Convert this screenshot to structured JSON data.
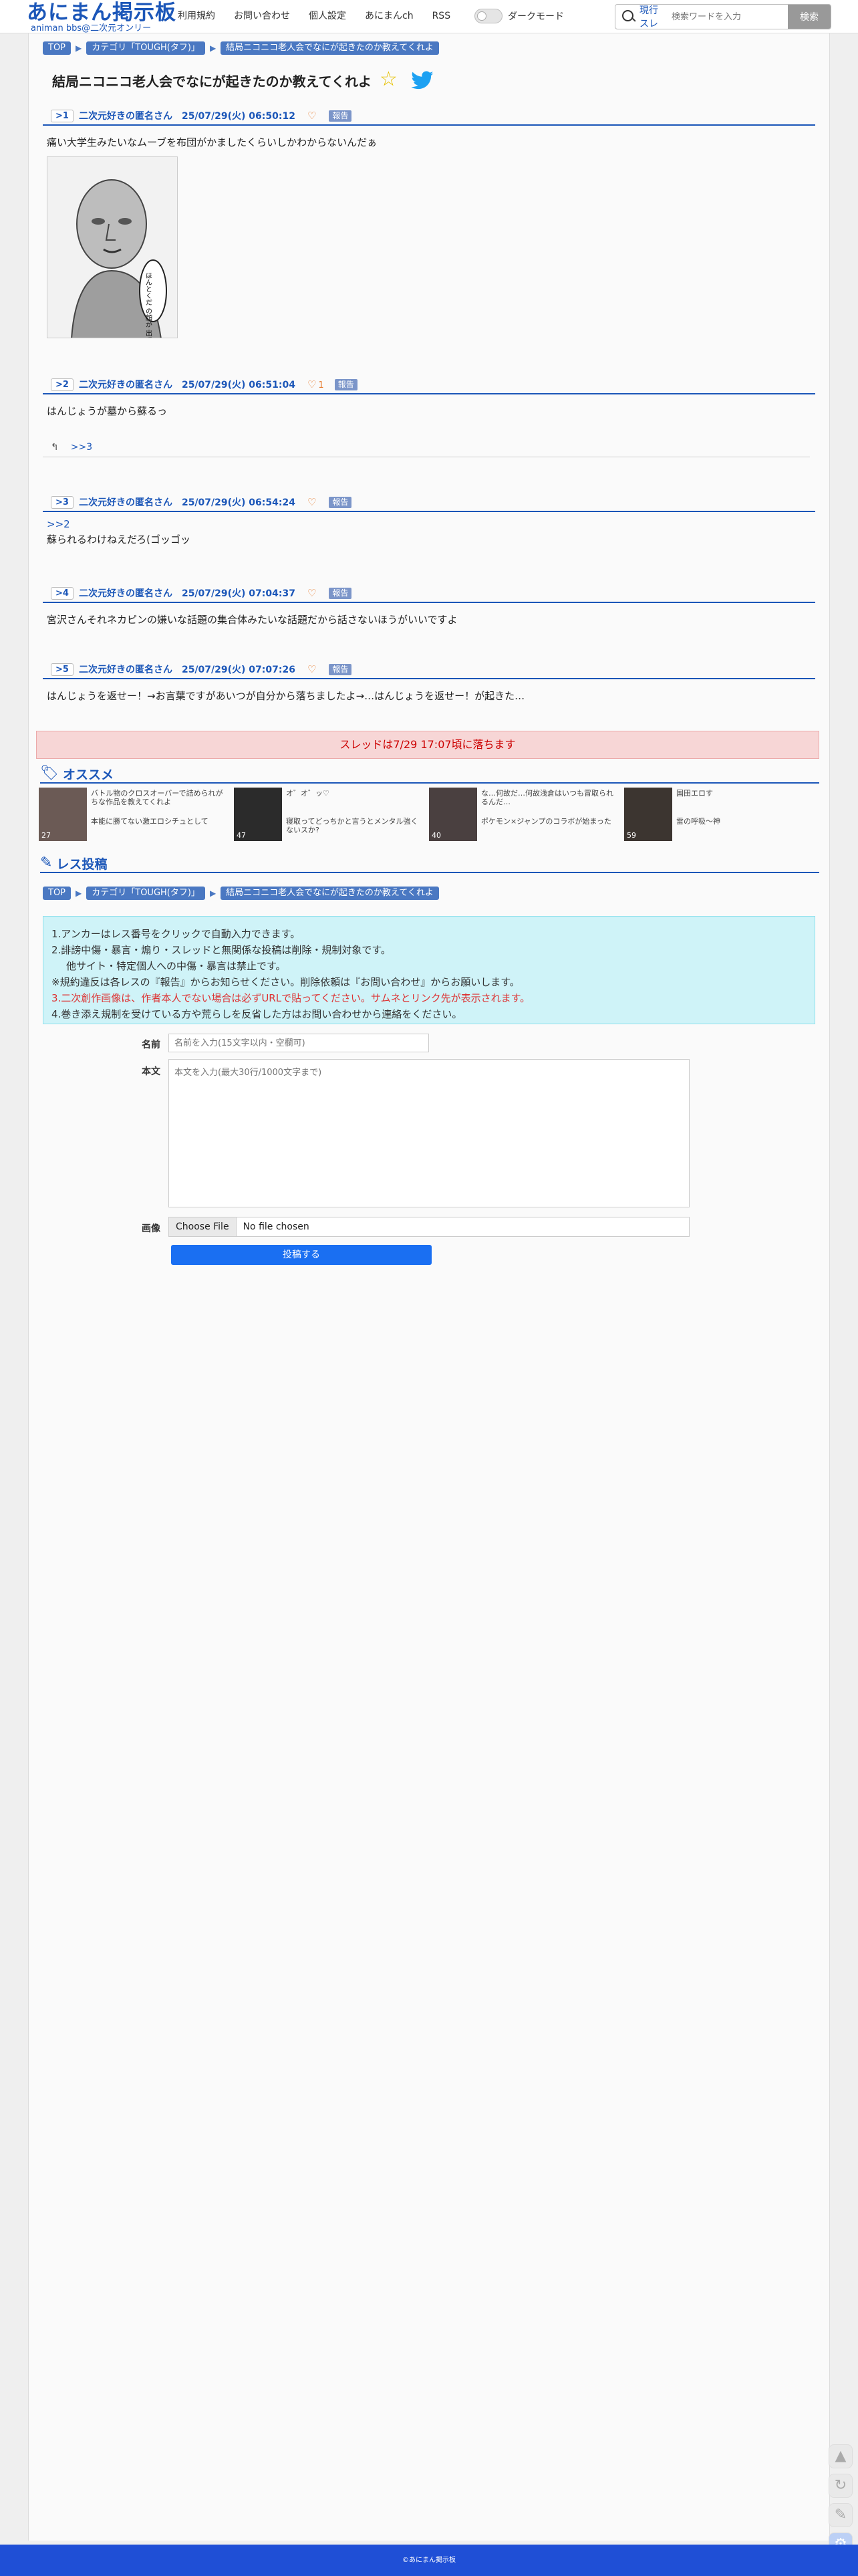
{
  "header": {
    "logo_main": "あにまん掲示板",
    "logo_sub": "animan bbs@二次元オンリー",
    "nav": [
      "利用規約",
      "お問い合わせ",
      "個人設定",
      "あにまんch",
      "RSS"
    ],
    "dark_mode_label": "ダークモード",
    "search_scope": "現行スレ",
    "search_placeholder": "検索ワードを入力",
    "search_button": "検索"
  },
  "breadcrumb": [
    "TOP",
    "カテゴリ「TOUGH(タフ)」",
    "結局ニコニコ老人会でなにが起きたのか教えてくれよ"
  ],
  "thread_title": "結局ニコニコ老人会でなにが起きたのか教えてくれよ",
  "posts": [
    {
      "num": ">1",
      "name": "二次元好きの匿名さん",
      "date": "25/07/29(火) 06:50:12",
      "likes": "",
      "report": "報告",
      "anchor": "",
      "body": "痛い大学生みたいなムーブを布団がかましたくらいしかわからないんだぁ"
    },
    {
      "num": ">2",
      "name": "二次元好きの匿名さん",
      "date": "25/07/29(火) 06:51:04",
      "likes": "1",
      "report": "報告",
      "anchor": "",
      "body": "はんじょうが墓から蘇るっ"
    },
    {
      "num": ">3",
      "name": "二次元好きの匿名さん",
      "date": "25/07/29(火) 06:54:24",
      "likes": "",
      "report": "報告",
      "anchor": ">>2",
      "body": "蘇られるわけねえだろ(ゴッゴッ"
    },
    {
      "num": ">4",
      "name": "二次元好きの匿名さん",
      "date": "25/07/29(火) 07:04:37",
      "likes": "",
      "report": "報告",
      "anchor": "",
      "body": "宮沢さんそれネカピンの嫌いな話題の集合体みたいな話題だから話さないほうがいいですよ"
    },
    {
      "num": ">5",
      "name": "二次元好きの匿名さん",
      "date": "25/07/29(火) 07:07:26",
      "likes": "",
      "report": "報告",
      "anchor": "",
      "body": "はんじょうを返せー！→お言葉ですがあいつが自分から落ちましたよ→…はんじょうを返せー！が起きた…"
    }
  ],
  "post1_image_caption": "ほんとくだ の顔が 出てきた",
  "post2_reply_link": ">>3",
  "expired_notice": "スレッドは7/29 17:07頃に落ちます",
  "recommend": {
    "heading": "オススメ",
    "items": [
      {
        "title": "バトル物のクロスオーバーで詰められがちな作品を教えてくれよ",
        "sub": "本能に勝てない激エロシチュとして",
        "count": "27"
      },
      {
        "title": "オ゛オ゛ッ♡",
        "sub": "寝取ってどっちかと言うとメンタル強くないスか?",
        "count": "47"
      },
      {
        "title": "な…何故だ…何故浅倉はいつも冒取られるんだ…",
        "sub": "ポケモン×ジャンプのコラボが始まった",
        "count": "40"
      },
      {
        "title": "国田エロす",
        "sub": "雷の呼吸～神",
        "count": "59"
      }
    ]
  },
  "form": {
    "heading": "レス投稿",
    "rules": [
      "1.アンカーはレス番号をクリックで自動入力できます。",
      "2.誹謗中傷・暴言・煽り・スレッドと無関係な投稿は削除・規制対象です。",
      "他サイト・特定個人への中傷・暴言は禁止です。",
      "※規約違反は各レスの『報告』からお知らせください。削除依頼は『お問い合わせ』からお願いします。",
      "3.二次創作画像は、作者本人でない場合は必ずURLで貼ってください。サムネとリンク先が表示されます。",
      "4.巻き添え規制を受けている方や荒らしを反省した方はお問い合わせから連絡をください。"
    ],
    "name_label": "名前",
    "name_placeholder": "名前を入力(15文字以内・空欄可)",
    "body_label": "本文",
    "body_placeholder": "本文を入力(最大30行/1000文字まで)",
    "image_label": "画像",
    "file_button": "Choose File",
    "file_status": "No file chosen",
    "submit": "投稿する"
  },
  "footer": "©あにまん掲示板",
  "colors": {
    "accent": "#1b56b8",
    "footer": "#1f4fd6",
    "submit": "#1a6ff2",
    "expired_bg": "#f7d6d6",
    "info_bg": "#cff3f8"
  }
}
